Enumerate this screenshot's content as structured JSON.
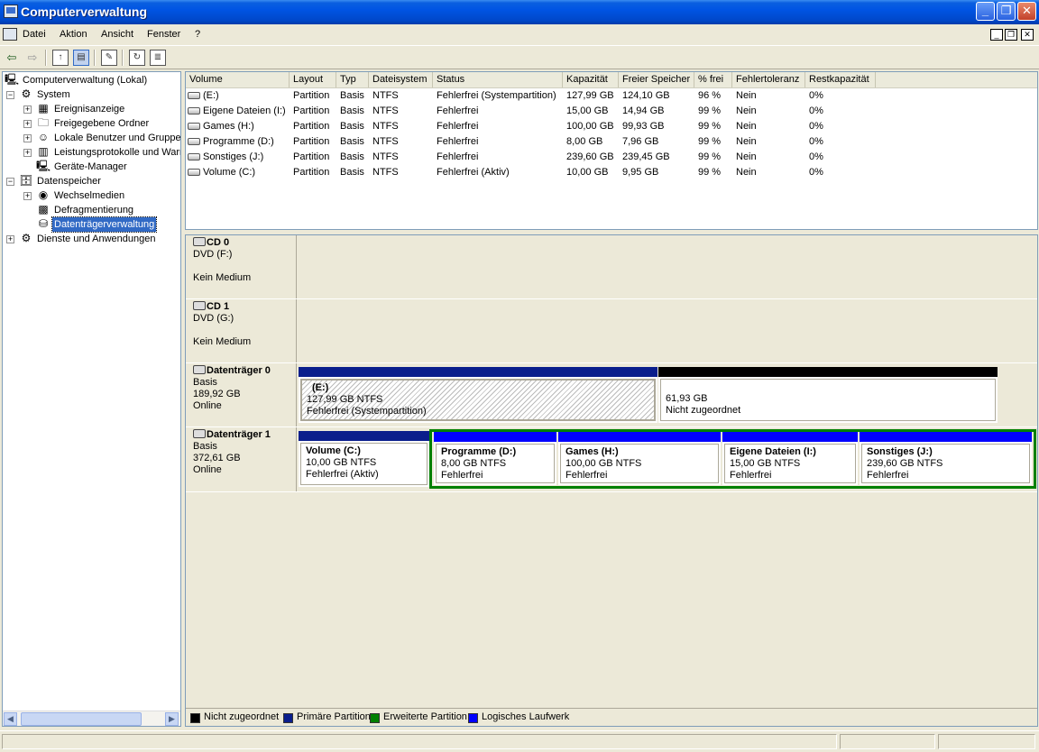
{
  "window": {
    "title": "Computerverwaltung"
  },
  "menu": [
    "Datei",
    "Aktion",
    "Ansicht",
    "Fenster",
    "?"
  ],
  "tree": [
    {
      "label": "Computerverwaltung (Lokal)",
      "level": 0,
      "expander": "",
      "icon": "computer-icon",
      "selected": false
    },
    {
      "label": "System",
      "level": 1,
      "expander": "−",
      "icon": "system-tools-icon",
      "selected": false
    },
    {
      "label": "Ereignisanzeige",
      "level": 2,
      "expander": "+",
      "icon": "event-viewer-icon",
      "selected": false
    },
    {
      "label": "Freigegebene Ordner",
      "level": 2,
      "expander": "+",
      "icon": "shared-folder-icon",
      "selected": false
    },
    {
      "label": "Lokale Benutzer und Gruppen",
      "level": 2,
      "expander": "+",
      "icon": "users-icon",
      "selected": false
    },
    {
      "label": "Leistungsprotokolle und Warnungen",
      "level": 2,
      "expander": "+",
      "icon": "performance-log-icon",
      "selected": false
    },
    {
      "label": "Geräte-Manager",
      "level": 2,
      "expander": "",
      "icon": "device-manager-icon",
      "selected": false
    },
    {
      "label": "Datenspeicher",
      "level": 1,
      "expander": "−",
      "icon": "storage-icon",
      "selected": false
    },
    {
      "label": "Wechselmedien",
      "level": 2,
      "expander": "+",
      "icon": "removable-media-icon",
      "selected": false
    },
    {
      "label": "Defragmentierung",
      "level": 2,
      "expander": "",
      "icon": "defrag-icon",
      "selected": false
    },
    {
      "label": "Datenträgerverwaltung",
      "level": 2,
      "expander": "",
      "icon": "disk-management-icon",
      "selected": true
    },
    {
      "label": "Dienste und Anwendungen",
      "level": 1,
      "expander": "+",
      "icon": "services-icon",
      "selected": false
    }
  ],
  "volumes": {
    "columns": [
      "Volume",
      "Layout",
      "Typ",
      "Dateisystem",
      "Status",
      "Kapazität",
      "Freier Speicher",
      "% frei",
      "Fehlertoleranz",
      "Restkapazität"
    ],
    "rows": [
      [
        "(E:)",
        "Partition",
        "Basis",
        "NTFS",
        "Fehlerfrei (Systempartition)",
        "127,99 GB",
        "124,10 GB",
        "96 %",
        "Nein",
        "0%"
      ],
      [
        "Eigene Dateien (I:)",
        "Partition",
        "Basis",
        "NTFS",
        "Fehlerfrei",
        "15,00 GB",
        "14,94 GB",
        "99 %",
        "Nein",
        "0%"
      ],
      [
        "Games (H:)",
        "Partition",
        "Basis",
        "NTFS",
        "Fehlerfrei",
        "100,00 GB",
        "99,93 GB",
        "99 %",
        "Nein",
        "0%"
      ],
      [
        "Programme (D:)",
        "Partition",
        "Basis",
        "NTFS",
        "Fehlerfrei",
        "8,00 GB",
        "7,96 GB",
        "99 %",
        "Nein",
        "0%"
      ],
      [
        "Sonstiges (J:)",
        "Partition",
        "Basis",
        "NTFS",
        "Fehlerfrei",
        "239,60 GB",
        "239,45 GB",
        "99 %",
        "Nein",
        "0%"
      ],
      [
        "Volume (C:)",
        "Partition",
        "Basis",
        "NTFS",
        "Fehlerfrei (Aktiv)",
        "10,00 GB",
        "9,95 GB",
        "99 %",
        "Nein",
        "0%"
      ]
    ]
  },
  "disks": [
    {
      "name": "CD 0",
      "lines": [
        "DVD (F:)",
        "",
        "Kein Medium"
      ]
    },
    {
      "name": "CD 1",
      "lines": [
        "DVD (G:)",
        "",
        "Kein Medium"
      ]
    },
    {
      "name": "Datenträger 0",
      "lines": [
        "Basis",
        "189,92 GB",
        "Online"
      ]
    },
    {
      "name": "Datenträger 1",
      "lines": [
        "Basis",
        "372,61 GB",
        "Online"
      ]
    }
  ],
  "disk0_parts": [
    {
      "title": "(E:)",
      "line1": "127,99 GB NTFS",
      "line2": "Fehlerfrei (Systempartition)"
    },
    {
      "title": "",
      "line1": "61,93 GB",
      "line2": "Nicht zugeordnet"
    }
  ],
  "disk1_parts": [
    {
      "title": "Volume  (C:)",
      "line1": "10,00 GB NTFS",
      "line2": "Fehlerfrei (Aktiv)"
    },
    {
      "title": "Programme  (D:)",
      "line1": "8,00 GB NTFS",
      "line2": "Fehlerfrei"
    },
    {
      "title": "Games  (H:)",
      "line1": "100,00 GB NTFS",
      "line2": "Fehlerfrei"
    },
    {
      "title": "Eigene Dateien  (I:)",
      "line1": "15,00 GB NTFS",
      "line2": "Fehlerfrei"
    },
    {
      "title": "Sonstiges  (J:)",
      "line1": "239,60 GB NTFS",
      "line2": "Fehlerfrei"
    }
  ],
  "legend": [
    {
      "label": "Nicht zugeordnet",
      "color": "#000000"
    },
    {
      "label": "Primäre Partition",
      "color": "#0a1e8c"
    },
    {
      "label": "Erweiterte Partition",
      "color": "#008000"
    },
    {
      "label": "Logisches Laufwerk",
      "color": "#0000ff"
    }
  ],
  "colors": {
    "primary": "#0a1e8c",
    "logical": "#0000ff",
    "extended": "#008000",
    "unallocated": "#000000",
    "selection": "#316ac5"
  }
}
